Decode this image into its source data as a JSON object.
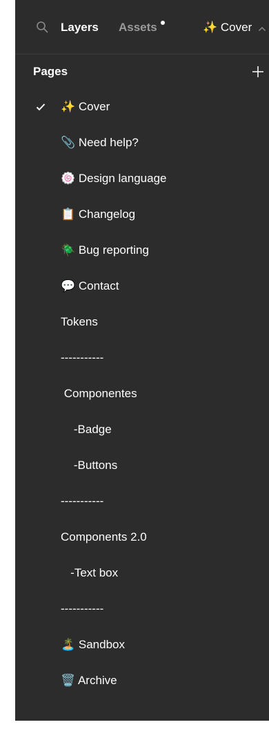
{
  "topbar": {
    "tabs": {
      "layers": "Layers",
      "assets": "Assets"
    },
    "current_page": "✨ Cover"
  },
  "pages_panel": {
    "title": "Pages",
    "items": [
      {
        "label": "✨ Cover",
        "selected": true
      },
      {
        "label": "📎 Need help?",
        "selected": false
      },
      {
        "label": "🍥 Design language",
        "selected": false
      },
      {
        "label": "📋 Changelog",
        "selected": false
      },
      {
        "label": "🪲 Bug reporting",
        "selected": false
      },
      {
        "label": "💬 Contact",
        "selected": false
      },
      {
        "label": "Tokens",
        "selected": false
      },
      {
        "label": "-----------",
        "selected": false
      },
      {
        "label": " Componentes",
        "selected": false
      },
      {
        "label": "    -Badge",
        "selected": false
      },
      {
        "label": "    -Buttons",
        "selected": false
      },
      {
        "label": "-----------",
        "selected": false
      },
      {
        "label": "Components 2.0",
        "selected": false
      },
      {
        "label": "   -Text box",
        "selected": false
      },
      {
        "label": "-----------",
        "selected": false
      },
      {
        "label": "🏝️ Sandbox",
        "selected": false
      },
      {
        "label": "🗑️ Archive",
        "selected": false
      }
    ]
  },
  "colors": {
    "panel_bg": "#2c2c2c",
    "text_primary": "#ffffff",
    "text_muted": "#9a9a9a"
  }
}
